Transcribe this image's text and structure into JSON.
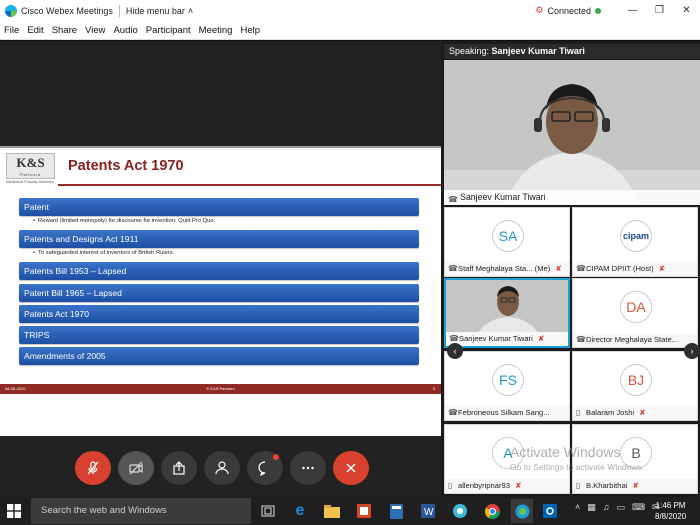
{
  "window": {
    "title": "Cisco Webex Meetings",
    "hide_menu_label": "Hide menu bar",
    "status": "Connected"
  },
  "menu": [
    "File",
    "Edit",
    "Share",
    "View",
    "Audio",
    "Participant",
    "Meeting",
    "Help"
  ],
  "slide": {
    "logo": "K&S",
    "logo_sub": "Partners",
    "logo_tagline": "Intellectual Property Attorneys",
    "title": "Patents Act 1970",
    "items": [
      {
        "label": "Patent",
        "bullet": "Reward (limited monopoly) for discourse for invention: Quid Pro Quo."
      },
      {
        "label": "Patents and Designs Act 1911",
        "bullet": "To safeguarded interest of inventors of British Rulers."
      },
      {
        "label": "Patents Bill 1953 – Lapsed",
        "bullet": ""
      },
      {
        "label": "Patent Bill 1965 – Lapsed",
        "bullet": ""
      },
      {
        "label": "Patents Act 1970",
        "bullet": ""
      },
      {
        "label": "TRIPS",
        "bullet": ""
      },
      {
        "label": "Amendments of 2005",
        "bullet": ""
      }
    ],
    "footer_date": "08-08-2020",
    "footer_name": "© K&S Partners",
    "footer_page": "3"
  },
  "panel": {
    "speaking_prefix": "Speaking:",
    "speaking_name": "Sanjeev Kumar Tiwari",
    "active_name": "Sanjeev Kumar Tiwari",
    "participants": [
      {
        "initials": "SA",
        "name": "Staff Meghalaya Sta... (Me)",
        "kind": "avatar",
        "color": "#1f9ac9"
      },
      {
        "initials": "cipam",
        "name": "CIPAM DPIIT (Host)",
        "kind": "logo",
        "color": "#1a4a8a"
      },
      {
        "initials": "",
        "name": "Sanjeev Kumar Tiwari",
        "kind": "video",
        "color": ""
      },
      {
        "initials": "DA",
        "name": "Director Meghalaya State...",
        "kind": "avatar",
        "color": "#d9563a"
      },
      {
        "initials": "FS",
        "name": "Febroneous Silkam Sang...",
        "kind": "avatar",
        "color": "#1f9ac9"
      },
      {
        "initials": "BJ",
        "name": "Balaram Joshi",
        "kind": "avatar",
        "color": "#d9563a"
      },
      {
        "initials": "A",
        "name": "allenbyripnar93",
        "kind": "avatar",
        "color": "#1f9ac9"
      },
      {
        "initials": "B",
        "name": "B.Kharbithai",
        "kind": "avatar",
        "color": "#555555"
      }
    ]
  },
  "watermark": {
    "line1": "Activate Windows",
    "line2": "Go to Settings to activate Windows."
  },
  "taskbar": {
    "search_placeholder": "Search the web and Windows",
    "time": "1:46 PM",
    "date": "8/8/2020"
  },
  "icons": {
    "mute": "microphone-muted-icon",
    "video": "video-off-icon",
    "share": "share-icon",
    "participants": "participants-icon",
    "chat": "chat-icon",
    "more": "more-icon",
    "leave": "leave-icon"
  }
}
